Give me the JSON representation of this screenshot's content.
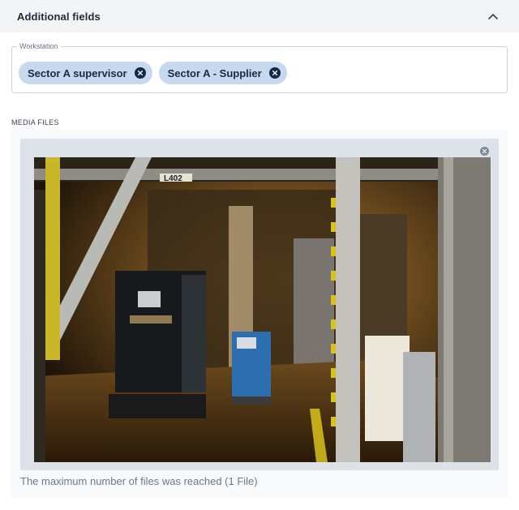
{
  "section": {
    "title": "Additional fields",
    "collapse_icon": "chevron-up-icon"
  },
  "workstation": {
    "label": "Workstation",
    "chips": [
      {
        "label": "Sector A supervisor",
        "remove_icon": "close-circle-icon"
      },
      {
        "label": "Sector A - Supplier",
        "remove_icon": "close-circle-icon"
      }
    ]
  },
  "media": {
    "label": "MEDIA FILES",
    "photo_sign": "L402",
    "remove_icon": "close-circle-icon",
    "limit_message": "The maximum number of files was reached (1 File)"
  },
  "colors": {
    "header_bg": "#f3f4f6",
    "chip_bg": "#c6d9ef",
    "chip_icon": "#0f2a4a",
    "card_bg": "#dde2e8"
  }
}
